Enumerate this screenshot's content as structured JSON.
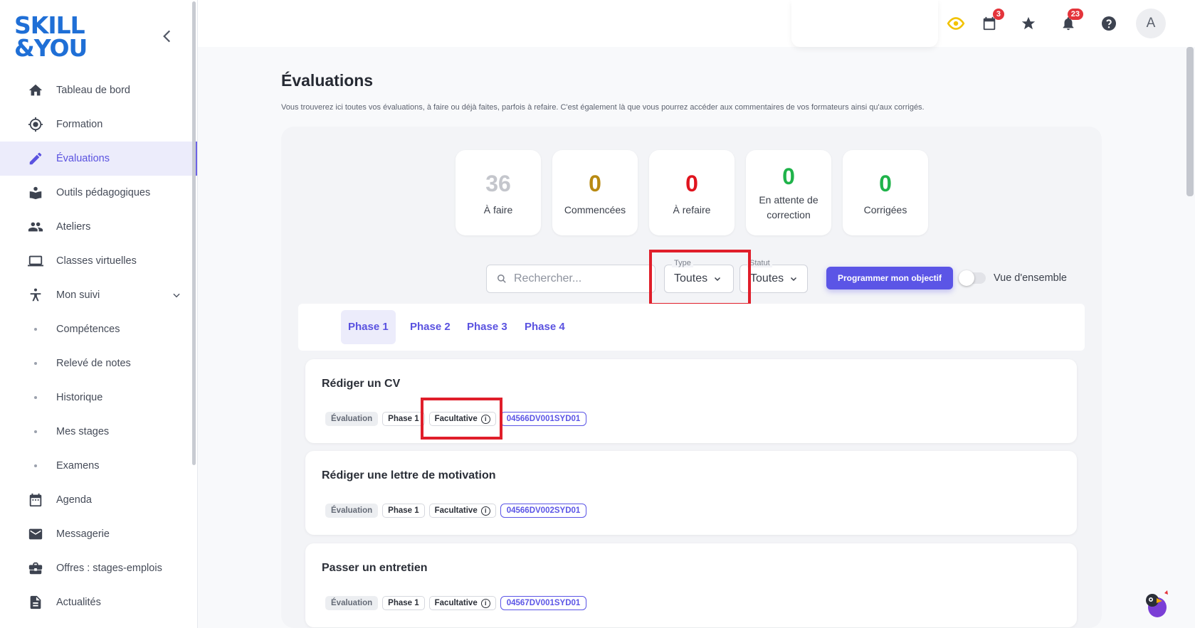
{
  "brand": {
    "line1": "SKILL",
    "line2": "&YOU"
  },
  "sidebar": {
    "items": [
      {
        "label": "Tableau de bord",
        "icon": "home-icon"
      },
      {
        "label": "Formation",
        "icon": "target-icon"
      },
      {
        "label": "Évaluations",
        "icon": "pencil-icon",
        "active": true
      },
      {
        "label": "Outils pédagogiques",
        "icon": "book-hand-icon"
      },
      {
        "label": "Ateliers",
        "icon": "group-icon"
      },
      {
        "label": "Classes virtuelles",
        "icon": "laptop-icon"
      },
      {
        "label": "Mon suivi",
        "icon": "person-balance-icon",
        "expandable": true
      },
      {
        "label": "Compétences",
        "sub": true
      },
      {
        "label": "Relevé de notes",
        "sub": true
      },
      {
        "label": "Historique",
        "sub": true
      },
      {
        "label": "Mes stages",
        "sub": true
      },
      {
        "label": "Examens",
        "sub": true
      },
      {
        "label": "Agenda",
        "icon": "calendar-icon"
      },
      {
        "label": "Messagerie",
        "icon": "mail-icon"
      },
      {
        "label": "Offres : stages-emplois",
        "icon": "briefcase-icon"
      },
      {
        "label": "Actualités",
        "icon": "news-icon"
      }
    ]
  },
  "topbar": {
    "calendar_badge": "3",
    "notifications_badge": "23",
    "avatar_initial": "A"
  },
  "page": {
    "title": "Évaluations",
    "description": "Vous trouverez ici toutes vos évaluations, à faire ou déjà faites, parfois à refaire. C'est également là que vous pourrez accéder aux commentaires de vos formateurs ainsi qu'aux corrigés."
  },
  "stats": [
    {
      "value": "36",
      "label": "À faire",
      "color": "#c4c6cc"
    },
    {
      "value": "0",
      "label": "Commencées",
      "color": "#b88a12"
    },
    {
      "value": "0",
      "label": "À refaire",
      "color": "#e0141e"
    },
    {
      "value": "0",
      "label": "En attente de correction",
      "color": "#1fb34a"
    },
    {
      "value": "0",
      "label": "Corrigées",
      "color": "#1fb34a"
    }
  ],
  "filters": {
    "search_placeholder": "Rechercher...",
    "type_legend": "Type",
    "type_value": "Toutes",
    "status_legend": "Statut",
    "status_value": "Toutes",
    "program_button": "Programmer mon objectif",
    "overview_label": "Vue d'ensemble"
  },
  "tabs": [
    "Phase 1",
    "Phase 2",
    "Phase 3",
    "Phase 4"
  ],
  "evaluations": [
    {
      "title": "Rédiger un CV",
      "kind": "Évaluation",
      "phase": "Phase 1",
      "optional": "Facultative",
      "code": "04566DV001SYD01"
    },
    {
      "title": "Rédiger une lettre de motivation",
      "kind": "Évaluation",
      "phase": "Phase 1",
      "optional": "Facultative",
      "code": "04566DV002SYD01"
    },
    {
      "title": "Passer un entretien",
      "kind": "Évaluation",
      "phase": "Phase 1",
      "optional": "Facultative",
      "code": "04567DV001SYD01"
    }
  ],
  "colors": {
    "accent": "#5b55e6",
    "highlight": "#e01e2a",
    "brand": "#1f6fd6"
  }
}
